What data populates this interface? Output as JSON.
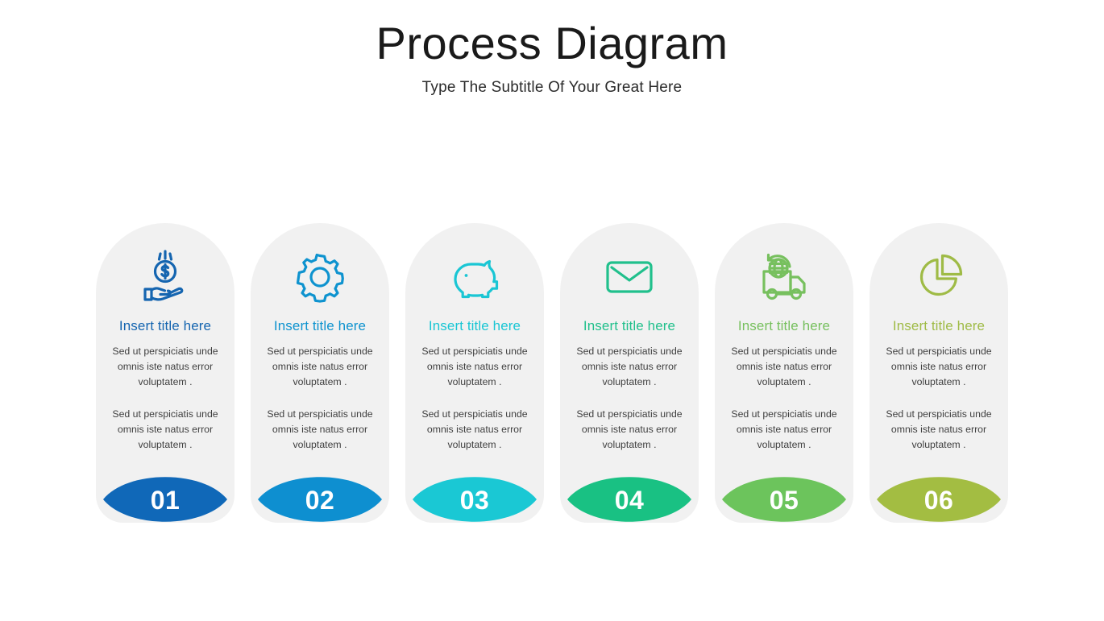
{
  "header": {
    "title": "Process Diagram",
    "subtitle": "Type The Subtitle Of Your Great Here"
  },
  "colors": {
    "card_background": "#f1f1f1",
    "page_background": "#ffffff",
    "title_text": "#1a1a1a",
    "body_text": "#3f3f3f",
    "badge_number_text": "#ffffff"
  },
  "cards": [
    {
      "number": "01",
      "title": "Insert title here",
      "paragraph1": "Sed ut perspiciatis unde omnis iste natus error voluptatem .",
      "paragraph2": "Sed ut perspiciatis unde omnis iste natus error voluptatem .",
      "icon": "hand-holding-coin-icon",
      "color": "#1565b0",
      "badge_color": "#1068b8"
    },
    {
      "number": "02",
      "title": "Insert title here",
      "paragraph1": "Sed ut perspiciatis unde omnis iste natus error voluptatem .",
      "paragraph2": "Sed ut perspiciatis unde omnis iste natus error voluptatem .",
      "icon": "gear-icon",
      "color": "#0e93cf",
      "badge_color": "#0e8fd0"
    },
    {
      "number": "03",
      "title": "Insert title here",
      "paragraph1": "Sed ut perspiciatis unde omnis iste natus error voluptatem .",
      "paragraph2": "Sed ut perspiciatis unde omnis iste natus error voluptatem .",
      "icon": "piggy-bank-icon",
      "color": "#1ac6d4",
      "badge_color": "#1ac8d4"
    },
    {
      "number": "04",
      "title": "Insert title here",
      "paragraph1": "Sed ut perspiciatis unde omnis iste natus error voluptatem .",
      "paragraph2": "Sed ut perspiciatis unde omnis iste natus error voluptatem .",
      "icon": "envelope-icon",
      "color": "#21c08c",
      "badge_color": "#19c183"
    },
    {
      "number": "05",
      "title": "Insert title here",
      "paragraph1": "Sed ut perspiciatis unde omnis iste natus error voluptatem .",
      "paragraph2": "Sed ut perspiciatis unde omnis iste natus error voluptatem .",
      "icon": "delivery-truck-globe-icon",
      "color": "#77c05e",
      "badge_color": "#6cc45c"
    },
    {
      "number": "06",
      "title": "Insert title here",
      "paragraph1": "Sed ut perspiciatis unde omnis iste natus error voluptatem .",
      "paragraph2": "Sed ut perspiciatis unde omnis iste natus error voluptatem .",
      "icon": "pie-chart-icon",
      "color": "#9fbb46",
      "badge_color": "#a3bd42"
    }
  ]
}
